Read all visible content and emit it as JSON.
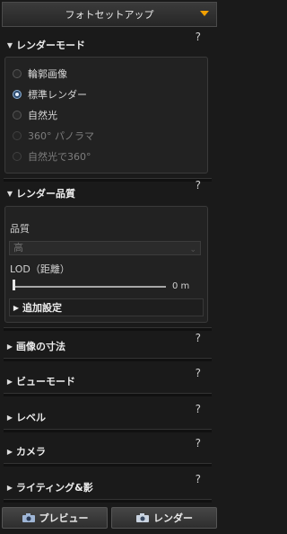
{
  "panel": {
    "title": "フォトセットアップ"
  },
  "sections": {
    "render_mode": {
      "title": "レンダーモード",
      "help": "?",
      "options": [
        {
          "label": "輪郭画像",
          "selected": false,
          "enabled": true
        },
        {
          "label": "標準レンダー",
          "selected": true,
          "enabled": true
        },
        {
          "label": "自然光",
          "selected": false,
          "enabled": true
        },
        {
          "label": "360° パノラマ",
          "selected": false,
          "enabled": false
        },
        {
          "label": "自然光で360°",
          "selected": false,
          "enabled": false
        }
      ]
    },
    "render_quality": {
      "title": "レンダー品質",
      "help": "?",
      "quality_label": "品質",
      "quality_value": "高",
      "lod_label": "LOD（距離）",
      "lod_value": "0 m",
      "advanced_title": "追加設定"
    },
    "image_size": {
      "title": "画像の寸法",
      "help": "?"
    },
    "view_mode": {
      "title": "ビューモード",
      "help": "?"
    },
    "level": {
      "title": "レベル",
      "help": "?"
    },
    "camera": {
      "title": "カメラ",
      "help": "?"
    },
    "lighting": {
      "title": "ライティング&影",
      "help": "?"
    }
  },
  "buttons": {
    "preview": "プレビュー",
    "render": "レンダー"
  },
  "colors": {
    "accent": "#f2a000",
    "radio_selected": "#2d4b6e"
  },
  "icons": {
    "title_dropdown": "chevron-down-icon",
    "section_open": "triangle-down-icon",
    "section_closed": "triangle-right-icon",
    "preview": "camera-icon",
    "render": "camera-icon"
  }
}
